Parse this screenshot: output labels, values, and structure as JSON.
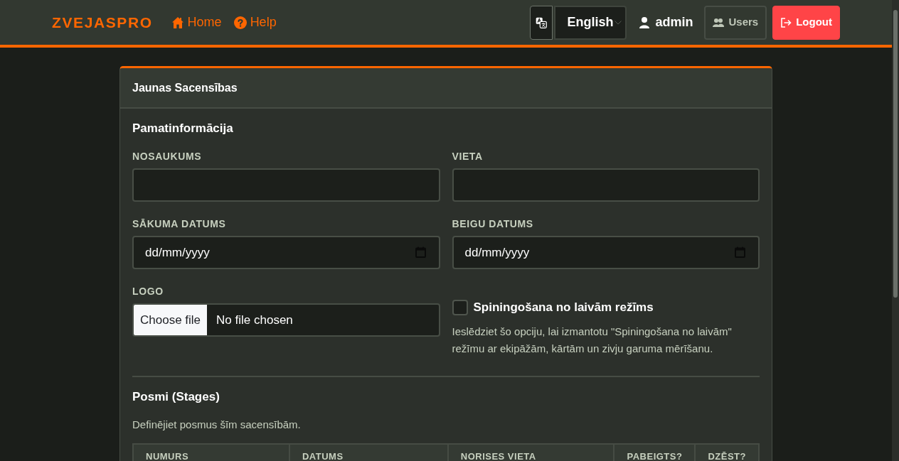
{
  "navbar": {
    "brand": "ZVEJASPRO",
    "links": [
      {
        "label": "Home"
      },
      {
        "label": "Help"
      }
    ],
    "language": {
      "value": "English"
    },
    "user": {
      "name": "admin"
    },
    "buttons": [
      {
        "label": "Users",
        "kind": "outline"
      },
      {
        "label": "Logout",
        "kind": "danger"
      }
    ]
  },
  "form": {
    "title": "Jaunas Sacensības",
    "basic": {
      "heading": "Pamatinformācija",
      "fields": [
        {
          "label": "NOSAUKUMS",
          "kind": "text"
        },
        {
          "label": "VIETA",
          "kind": "text"
        },
        {
          "label": "SĀKUMA DATUMS",
          "kind": "date",
          "placeholder": "dd/mm/yyyy"
        },
        {
          "label": "BEIGU DATUMS",
          "kind": "date",
          "placeholder": "dd/mm/yyyy"
        },
        {
          "label": "LOGO",
          "kind": "file",
          "button": "Choose file",
          "status": "No file chosen"
        }
      ],
      "option": {
        "label": "Spiningošana no laivām režīms",
        "checked": false,
        "help": "Ieslēdziet šo opciju, lai izmantotu \"Spiningošana no laivām\" režīmu ar ekipāžām, kārtām un zivju garuma mērīšanu."
      }
    },
    "stages": {
      "heading": "Posmi (Stages)",
      "description": "Definējiet posmus šīm sacensībām.",
      "table": {
        "columns": [
          "NUMURS",
          "DATUMS",
          "NORISES VIETA",
          "PABEIGTS?",
          "DZĒST?"
        ]
      }
    }
  }
}
